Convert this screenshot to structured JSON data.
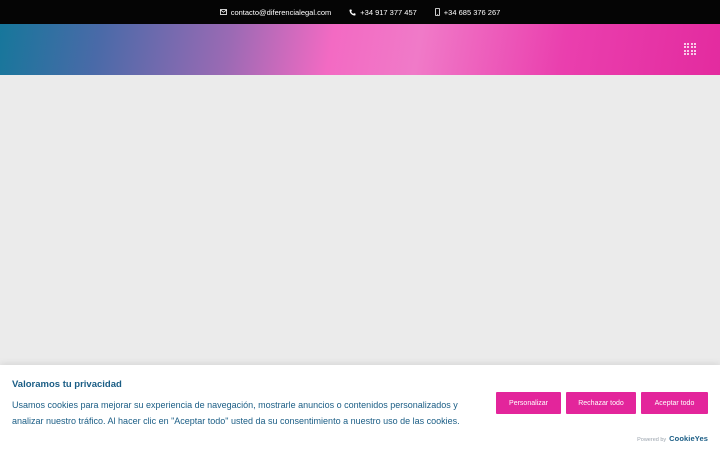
{
  "topbar": {
    "email": "contacto@diferencialegal.com",
    "phone": "+34 917 377 457",
    "mobile": "+34 685 376 267"
  },
  "header": {
    "menu_icon": "grid-menu-icon"
  },
  "cookie_banner": {
    "title": "Valoramos tu privacidad",
    "text": "Usamos cookies para mejorar su experiencia de navegación, mostrarle anuncios o contenidos personalizados y analizar nuestro tráfico. Al hacer clic en \"Aceptar todo\" usted da su consentimiento a nuestro uso de las cookies.",
    "buttons": {
      "customize": "Personalizar",
      "reject": "Rechazar todo",
      "accept": "Aceptar todo"
    },
    "powered_by": "Powered by",
    "brand": "CookieYes"
  },
  "colors": {
    "topbar_bg": "#050505",
    "accent_pink": "#e3259b",
    "text_blue": "#1a5d85",
    "content_bg": "#ebebeb"
  }
}
